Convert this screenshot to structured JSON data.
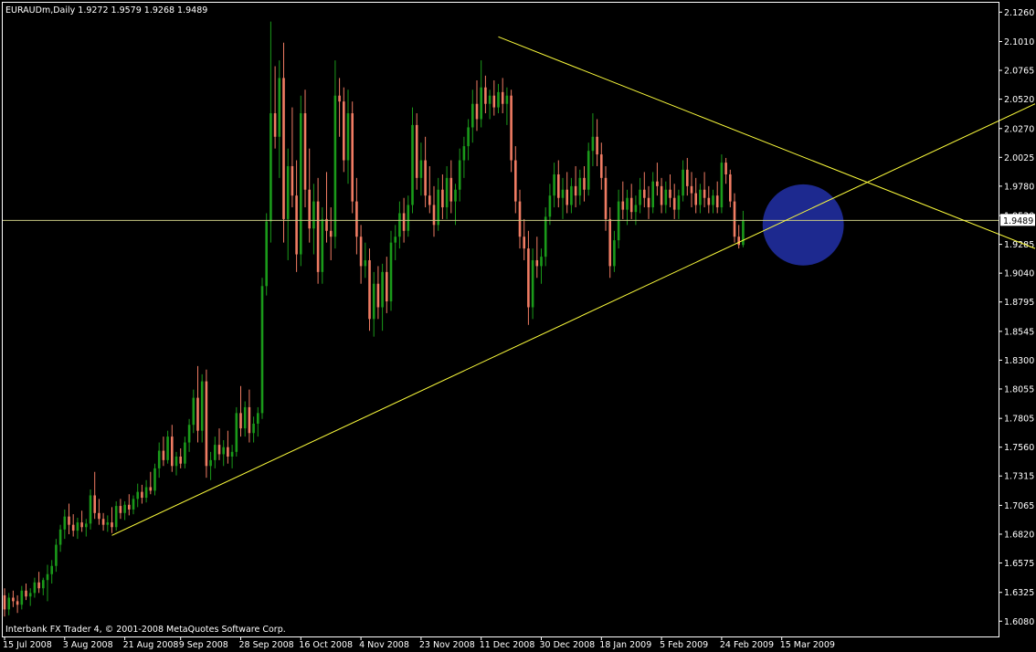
{
  "window": {
    "symbol_line": "EURAUDm,Daily  1.9272 1.9579 1.9268 1.9489",
    "copyright": "Interbank FX Trader 4, © 2001-2008 MetaQuotes Software Corp."
  },
  "colors": {
    "background": "#000000",
    "frame": "#ffffff",
    "bull": "#1a9a1a",
    "bear": "#f07c63",
    "trendline": "#ffff3c",
    "price_line": "#c8c882",
    "highlight_circle": "#1f2c9b",
    "bid_label_bg": "#ffffff",
    "bid_label_text": "#000000"
  },
  "chart_data": {
    "type": "candlestick",
    "symbol": "EURAUDm",
    "timeframe": "Daily",
    "last_bar": {
      "open": 1.9272,
      "high": 1.9579,
      "low": 1.9268,
      "close": 1.9489
    },
    "current_price_label": "1.9489",
    "ylim": [
      1.595,
      2.134
    ],
    "y_ticks": [
      {
        "value": 2.126,
        "label": "2.1260"
      },
      {
        "value": 2.101,
        "label": "2.1010"
      },
      {
        "value": 2.0765,
        "label": "2.0765"
      },
      {
        "value": 2.052,
        "label": "2.0520"
      },
      {
        "value": 2.027,
        "label": "2.0270"
      },
      {
        "value": 2.0025,
        "label": "2.0025"
      },
      {
        "value": 1.978,
        "label": "1.9780"
      },
      {
        "value": 1.953,
        "label": "1.9530"
      },
      {
        "value": 1.9285,
        "label": "1.9285"
      },
      {
        "value": 1.904,
        "label": "1.9040"
      },
      {
        "value": 1.8795,
        "label": "1.8795"
      },
      {
        "value": 1.8545,
        "label": "1.8545"
      },
      {
        "value": 1.83,
        "label": "1.8300"
      },
      {
        "value": 1.8055,
        "label": "1.8055"
      },
      {
        "value": 1.7805,
        "label": "1.7805"
      },
      {
        "value": 1.756,
        "label": "1.7560"
      },
      {
        "value": 1.7315,
        "label": "1.7315"
      },
      {
        "value": 1.7065,
        "label": "1.7065"
      },
      {
        "value": 1.682,
        "label": "1.6820"
      },
      {
        "value": 1.6575,
        "label": "1.6575"
      },
      {
        "value": 1.6325,
        "label": "1.6325"
      },
      {
        "value": 1.608,
        "label": "1.6080"
      }
    ],
    "x_ticks": [
      {
        "bar": 0,
        "label": "15 Jul 2008"
      },
      {
        "bar": 14,
        "label": "3 Aug 2008"
      },
      {
        "bar": 28,
        "label": "21 Aug 2008"
      },
      {
        "bar": 41,
        "label": "9 Sep 2008"
      },
      {
        "bar": 55,
        "label": "28 Sep 2008"
      },
      {
        "bar": 69,
        "label": "16 Oct 2008"
      },
      {
        "bar": 83,
        "label": "4 Nov 2008"
      },
      {
        "bar": 97,
        "label": "23 Nov 2008"
      },
      {
        "bar": 111,
        "label": "11 Dec 2008"
      },
      {
        "bar": 125,
        "label": "30 Dec 2008"
      },
      {
        "bar": 139,
        "label": "18 Jan 2009"
      },
      {
        "bar": 153,
        "label": "5 Feb 2009"
      },
      {
        "bar": 167,
        "label": "24 Feb 2009"
      },
      {
        "bar": 181,
        "label": "15 Mar 2009"
      }
    ],
    "trendlines": [
      {
        "name": "support",
        "from": {
          "bar": 25,
          "price": 1.681
        },
        "to": {
          "bar": 240,
          "price": 2.048
        }
      },
      {
        "name": "resistance",
        "from": {
          "bar": 115,
          "price": 2.105
        },
        "to": {
          "bar": 240,
          "price": 1.925
        }
      }
    ],
    "horizontal_line": {
      "price": 1.9489
    },
    "highlight": {
      "bar": 186,
      "price": 1.945,
      "radius_price": 0.0345
    },
    "bars": [
      [
        1.63,
        1.636,
        1.612,
        1.618
      ],
      [
        1.618,
        1.632,
        1.613,
        1.628
      ],
      [
        1.628,
        1.634,
        1.62,
        1.625
      ],
      [
        1.625,
        1.63,
        1.615,
        1.622
      ],
      [
        1.622,
        1.638,
        1.618,
        1.634
      ],
      [
        1.634,
        1.64,
        1.626,
        1.629
      ],
      [
        1.629,
        1.636,
        1.621,
        1.632
      ],
      [
        1.632,
        1.645,
        1.628,
        1.641
      ],
      [
        1.641,
        1.65,
        1.632,
        1.636
      ],
      [
        1.636,
        1.645,
        1.63,
        1.643
      ],
      [
        1.643,
        1.656,
        1.625,
        1.648
      ],
      [
        1.648,
        1.66,
        1.64,
        1.655
      ],
      [
        1.655,
        1.678,
        1.65,
        1.673
      ],
      [
        1.673,
        1.69,
        1.667,
        1.686
      ],
      [
        1.686,
        1.703,
        1.678,
        1.697
      ],
      [
        1.697,
        1.708,
        1.682,
        1.69
      ],
      [
        1.69,
        1.699,
        1.68,
        1.685
      ],
      [
        1.685,
        1.696,
        1.678,
        1.692
      ],
      [
        1.692,
        1.702,
        1.684,
        1.688
      ],
      [
        1.688,
        1.695,
        1.68,
        1.691
      ],
      [
        1.691,
        1.72,
        1.686,
        1.715
      ],
      [
        1.715,
        1.735,
        1.695,
        1.7
      ],
      [
        1.7,
        1.712,
        1.69,
        1.695
      ],
      [
        1.695,
        1.7,
        1.685,
        1.69
      ],
      [
        1.69,
        1.698,
        1.684,
        1.692
      ],
      [
        1.692,
        1.705,
        1.683,
        1.688
      ],
      [
        1.688,
        1.71,
        1.685,
        1.706
      ],
      [
        1.706,
        1.712,
        1.695,
        1.7
      ],
      [
        1.7,
        1.71,
        1.694,
        1.707
      ],
      [
        1.707,
        1.716,
        1.698,
        1.703
      ],
      [
        1.703,
        1.715,
        1.699,
        1.712
      ],
      [
        1.712,
        1.725,
        1.705,
        1.718
      ],
      [
        1.718,
        1.724,
        1.708,
        1.713
      ],
      [
        1.713,
        1.728,
        1.709,
        1.722
      ],
      [
        1.722,
        1.735,
        1.716,
        1.719
      ],
      [
        1.719,
        1.742,
        1.715,
        1.738
      ],
      [
        1.738,
        1.76,
        1.73,
        1.753
      ],
      [
        1.753,
        1.765,
        1.74,
        1.745
      ],
      [
        1.745,
        1.77,
        1.742,
        1.765
      ],
      [
        1.765,
        1.775,
        1.735,
        1.74
      ],
      [
        1.74,
        1.752,
        1.732,
        1.748
      ],
      [
        1.748,
        1.755,
        1.738,
        1.742
      ],
      [
        1.742,
        1.765,
        1.738,
        1.76
      ],
      [
        1.76,
        1.78,
        1.752,
        1.775
      ],
      [
        1.775,
        1.805,
        1.768,
        1.798
      ],
      [
        1.798,
        1.825,
        1.76,
        1.77
      ],
      [
        1.77,
        1.818,
        1.76,
        1.812
      ],
      [
        1.812,
        1.822,
        1.73,
        1.74
      ],
      [
        1.74,
        1.752,
        1.728,
        1.745
      ],
      [
        1.745,
        1.765,
        1.738,
        1.758
      ],
      [
        1.758,
        1.772,
        1.745,
        1.75
      ],
      [
        1.75,
        1.762,
        1.74,
        1.756
      ],
      [
        1.756,
        1.77,
        1.742,
        1.748
      ],
      [
        1.748,
        1.758,
        1.738,
        1.752
      ],
      [
        1.752,
        1.79,
        1.748,
        1.785
      ],
      [
        1.785,
        1.808,
        1.765,
        1.772
      ],
      [
        1.772,
        1.795,
        1.765,
        1.79
      ],
      [
        1.79,
        1.805,
        1.76,
        1.768
      ],
      [
        1.768,
        1.782,
        1.76,
        1.776
      ],
      [
        1.776,
        1.79,
        1.765,
        1.785
      ],
      [
        1.785,
        1.9,
        1.78,
        1.893
      ],
      [
        1.893,
        1.955,
        1.885,
        1.948
      ],
      [
        1.948,
        2.118,
        1.93,
        2.04
      ],
      [
        2.04,
        2.08,
        2.01,
        2.02
      ],
      [
        2.02,
        2.085,
        1.985,
        2.07
      ],
      [
        2.07,
        2.1,
        1.93,
        1.95
      ],
      [
        1.95,
        2.01,
        1.915,
        1.995
      ],
      [
        1.995,
        2.045,
        1.96,
        1.97
      ],
      [
        1.97,
        2.0,
        1.905,
        1.92
      ],
      [
        1.92,
        2.055,
        1.91,
        2.04
      ],
      [
        2.04,
        2.06,
        1.96,
        1.975
      ],
      [
        1.975,
        2.01,
        1.93,
        1.942
      ],
      [
        1.942,
        1.98,
        1.92,
        1.965
      ],
      [
        1.965,
        1.985,
        1.895,
        1.905
      ],
      [
        1.905,
        1.96,
        1.895,
        1.95
      ],
      [
        1.95,
        1.99,
        1.93,
        1.94
      ],
      [
        1.94,
        1.96,
        1.915,
        1.935
      ],
      [
        1.935,
        2.085,
        1.925,
        2.055
      ],
      [
        2.055,
        2.07,
        2.02,
        2.05
      ],
      [
        2.05,
        2.062,
        1.99,
        2.0
      ],
      [
        2.0,
        2.06,
        1.98,
        2.04
      ],
      [
        2.04,
        2.05,
        1.955,
        1.965
      ],
      [
        1.965,
        1.985,
        1.92,
        1.935
      ],
      [
        1.935,
        1.945,
        1.895,
        1.91
      ],
      [
        1.91,
        1.93,
        1.9,
        1.915
      ],
      [
        1.915,
        1.925,
        1.855,
        1.865
      ],
      [
        1.865,
        1.905,
        1.85,
        1.895
      ],
      [
        1.895,
        1.91,
        1.865,
        1.875
      ],
      [
        1.875,
        1.912,
        1.855,
        1.905
      ],
      [
        1.905,
        1.918,
        1.87,
        1.88
      ],
      [
        1.88,
        1.94,
        1.872,
        1.93
      ],
      [
        1.93,
        1.945,
        1.915,
        1.935
      ],
      [
        1.935,
        1.965,
        1.925,
        1.955
      ],
      [
        1.955,
        1.968,
        1.93,
        1.94
      ],
      [
        1.94,
        1.97,
        1.935,
        1.962
      ],
      [
        1.962,
        2.045,
        1.955,
        2.03
      ],
      [
        2.03,
        2.04,
        1.975,
        1.985
      ],
      [
        1.985,
        2.015,
        1.97,
        2.0
      ],
      [
        2.0,
        2.02,
        1.96,
        1.97
      ],
      [
        1.97,
        1.995,
        1.955,
        1.962
      ],
      [
        1.962,
        1.978,
        1.935,
        1.945
      ],
      [
        1.945,
        1.985,
        1.94,
        1.975
      ],
      [
        1.975,
        1.988,
        1.95,
        1.96
      ],
      [
        1.96,
        1.995,
        1.95,
        1.985
      ],
      [
        1.985,
        2.0,
        1.955,
        1.965
      ],
      [
        1.965,
        1.98,
        1.945,
        1.975
      ],
      [
        1.975,
        2.01,
        1.965,
        2.0
      ],
      [
        2.0,
        2.02,
        1.985,
        2.012
      ],
      [
        2.012,
        2.035,
        2.0,
        2.028
      ],
      [
        2.028,
        2.06,
        2.015,
        2.048
      ],
      [
        2.048,
        2.068,
        2.025,
        2.035
      ],
      [
        2.035,
        2.085,
        2.028,
        2.062
      ],
      [
        2.062,
        2.072,
        2.04,
        2.048
      ],
      [
        2.048,
        2.06,
        2.035,
        2.055
      ],
      [
        2.055,
        2.068,
        2.038,
        2.045
      ],
      [
        2.045,
        2.065,
        2.04,
        2.058
      ],
      [
        2.058,
        2.07,
        2.04,
        2.048
      ],
      [
        2.048,
        2.062,
        2.03,
        2.055
      ],
      [
        2.055,
        2.06,
        1.99,
        2.0
      ],
      [
        2.0,
        2.012,
        1.955,
        1.965
      ],
      [
        1.965,
        1.975,
        1.925,
        1.935
      ],
      [
        1.935,
        1.95,
        1.915,
        1.925
      ],
      [
        1.925,
        1.94,
        1.86,
        1.875
      ],
      [
        1.875,
        1.925,
        1.865,
        1.915
      ],
      [
        1.915,
        1.935,
        1.9,
        1.91
      ],
      [
        1.91,
        1.925,
        1.895,
        1.918
      ],
      [
        1.918,
        1.96,
        1.91,
        1.952
      ],
      [
        1.952,
        1.98,
        1.945,
        1.97
      ],
      [
        1.97,
        1.998,
        1.96,
        1.988
      ],
      [
        1.988,
        2.0,
        1.96,
        1.968
      ],
      [
        1.968,
        1.985,
        1.95,
        1.975
      ],
      [
        1.975,
        1.99,
        1.955,
        1.962
      ],
      [
        1.962,
        1.985,
        1.955,
        1.978
      ],
      [
        1.978,
        1.995,
        1.96,
        1.97
      ],
      [
        1.97,
        1.992,
        1.962,
        1.985
      ],
      [
        1.985,
        1.995,
        1.965,
        1.975
      ],
      [
        1.975,
        2.015,
        1.97,
        2.008
      ],
      [
        2.008,
        2.04,
        1.995,
        2.02
      ],
      [
        2.02,
        2.035,
        1.995,
        2.005
      ],
      [
        2.005,
        2.015,
        1.975,
        1.985
      ],
      [
        1.985,
        1.995,
        1.94,
        1.95
      ],
      [
        1.95,
        1.96,
        1.9,
        1.91
      ],
      [
        1.91,
        1.94,
        1.905,
        1.932
      ],
      [
        1.932,
        1.975,
        1.925,
        1.965
      ],
      [
        1.965,
        1.982,
        1.95,
        1.958
      ],
      [
        1.958,
        1.975,
        1.945,
        1.968
      ],
      [
        1.968,
        1.98,
        1.95,
        1.956
      ],
      [
        1.956,
        1.97,
        1.945,
        1.962
      ],
      [
        1.962,
        1.985,
        1.955,
        1.975
      ],
      [
        1.975,
        1.99,
        1.96,
        1.968
      ],
      [
        1.968,
        1.978,
        1.95,
        1.96
      ],
      [
        1.96,
        1.99,
        1.955,
        1.982
      ],
      [
        1.982,
        1.998,
        1.97,
        1.978
      ],
      [
        1.978,
        1.985,
        1.955,
        1.962
      ],
      [
        1.962,
        1.982,
        1.955,
        1.975
      ],
      [
        1.975,
        1.988,
        1.96,
        1.968
      ],
      [
        1.968,
        1.98,
        1.95,
        1.958
      ],
      [
        1.958,
        1.975,
        1.95,
        1.97
      ],
      [
        1.97,
        2.0,
        1.965,
        1.992
      ],
      [
        1.992,
        2.002,
        1.97,
        1.978
      ],
      [
        1.978,
        1.99,
        1.96,
        1.972
      ],
      [
        1.972,
        1.985,
        1.955,
        1.962
      ],
      [
        1.962,
        1.98,
        1.955,
        1.975
      ],
      [
        1.975,
        1.99,
        1.96,
        1.968
      ],
      [
        1.968,
        1.978,
        1.955,
        1.962
      ],
      [
        1.962,
        1.975,
        1.955,
        1.97
      ],
      [
        1.97,
        1.982,
        1.955,
        1.96
      ],
      [
        1.96,
        2.005,
        1.955,
        1.998
      ],
      [
        1.998,
        2.002,
        1.98,
        1.988
      ],
      [
        1.988,
        1.992,
        1.96,
        1.965
      ],
      [
        1.965,
        1.972,
        1.93,
        1.935
      ],
      [
        1.935,
        1.945,
        1.925,
        1.928
      ],
      [
        1.928,
        1.957,
        1.926,
        1.949
      ]
    ]
  }
}
